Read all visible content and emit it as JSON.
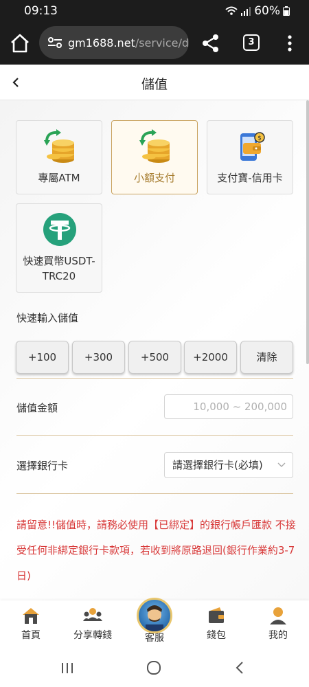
{
  "status_bar": {
    "time": "09:13",
    "battery": "60%"
  },
  "browser": {
    "url_domain": "gm1688.net",
    "url_path": "/service/dep",
    "tab_count": "3"
  },
  "header": {
    "title": "儲值"
  },
  "payment_methods": [
    {
      "label": "專屬ATM",
      "icon": "coins-exchange-icon",
      "selected": false
    },
    {
      "label": "小額支付",
      "icon": "coins-exchange-icon",
      "selected": true
    },
    {
      "label": "支付寶-信用卡",
      "icon": "phone-wallet-icon",
      "selected": false
    },
    {
      "label": "快速買幣USDT-TRC20",
      "label_line1": "快速買幣USDT-",
      "label_line2": "TRC20",
      "icon": "tether-icon",
      "selected": false
    }
  ],
  "quick_input": {
    "label": "快速輸入儲值",
    "buttons": [
      "+100",
      "+300",
      "+500",
      "+2000",
      "清除"
    ]
  },
  "amount": {
    "label": "儲值金額",
    "placeholder": "10,000 ~ 200,000"
  },
  "bank": {
    "label": "選擇銀行卡",
    "selected": "請選擇銀行卡(必填)"
  },
  "notice": "請留意!!儲值時，請務必使用【已綁定】的銀行帳戶匯款 不接受任何非綁定銀行卡款項，若收到將原路退回(銀行作業約3-7日)",
  "bottom_nav": [
    {
      "label": "首頁",
      "icon": "home-icon"
    },
    {
      "label": "分享轉錢",
      "icon": "share-people-icon"
    },
    {
      "label": "客服",
      "icon": "customer-service-avatar"
    },
    {
      "label": "錢包",
      "icon": "wallet-icon"
    },
    {
      "label": "我的",
      "icon": "user-icon"
    }
  ],
  "colors": {
    "accent_gold": "#c9a25e",
    "notice_red": "#d83a3a",
    "chrome_dark": "#1c1c1c"
  }
}
